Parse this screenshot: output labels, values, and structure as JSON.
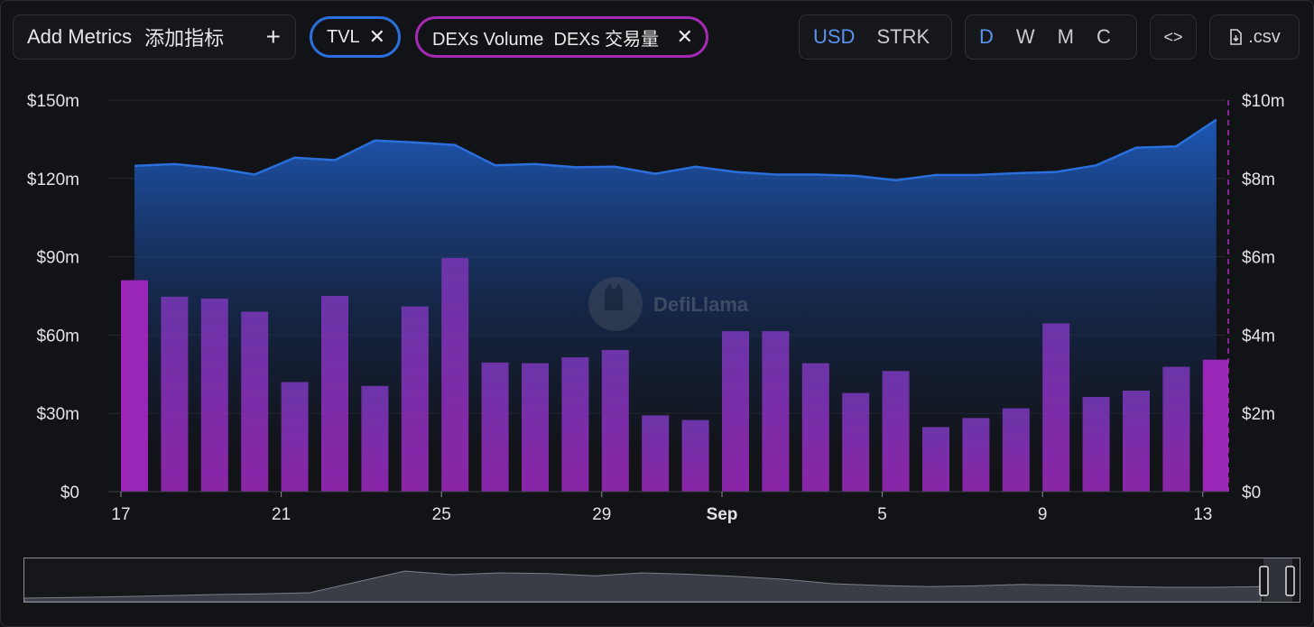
{
  "toolbar": {
    "add_metrics_label": "Add Metrics",
    "add_metrics_cn": "添加指标",
    "add_icon": "plus-icon",
    "active_metrics": [
      {
        "label": "TVL",
        "color": "#2a6fdb"
      },
      {
        "label": "DEXs Volume  DEXs 交易量",
        "color": "#a42ab4"
      }
    ],
    "remove_icon": "close-icon",
    "currency_options": [
      "USD",
      "STRK"
    ],
    "currency_selected": "USD",
    "granularity_options": [
      "D",
      "W",
      "M",
      "C"
    ],
    "granularity_selected": "D",
    "embed_label": "<>",
    "csv_label": ".csv",
    "csv_icon": "download-file-icon"
  },
  "watermark": "DefiLlama",
  "chart_data": {
    "type": "bar",
    "x_tick_labels": [
      "17",
      "21",
      "25",
      "29",
      "Sep",
      "5",
      "9",
      "13"
    ],
    "x_tick_positions_day_index": [
      0,
      4,
      8,
      12,
      15,
      19,
      23,
      27
    ],
    "left_axis": {
      "ticks": [
        "$0",
        "$30m",
        "$60m",
        "$90m",
        "$120m",
        "$150m"
      ],
      "ylim": [
        0,
        150
      ]
    },
    "right_axis": {
      "ticks": [
        "$0",
        "$2m",
        "$4m",
        "$6m",
        "$8m",
        "$10m"
      ],
      "ylim": [
        0,
        10
      ]
    },
    "series": [
      {
        "name": "TVL",
        "kind": "area",
        "axis": "left",
        "unit": "$m",
        "color": "#2a6fdb",
        "values": [
          124.8,
          125.5,
          124.0,
          121.5,
          128.0,
          127.0,
          134.5,
          133.8,
          132.8,
          125.0,
          125.5,
          124.3,
          124.5,
          121.8,
          124.5,
          122.5,
          121.5,
          121.5,
          121.0,
          119.3,
          121.3,
          121.3,
          122.0,
          122.5,
          125.0,
          131.8,
          132.3,
          142.5
        ]
      },
      {
        "name": "DEXs Volume",
        "kind": "bar",
        "axis": "right",
        "unit": "$m",
        "color": "#8e2bb0",
        "values": [
          5.4,
          4.98,
          4.93,
          4.6,
          2.8,
          5.0,
          2.7,
          4.73,
          5.97,
          3.3,
          3.28,
          3.43,
          3.62,
          1.95,
          1.83,
          4.1,
          4.1,
          3.28,
          2.52,
          3.08,
          1.65,
          1.88,
          2.13,
          4.3,
          2.42,
          2.58,
          3.19,
          3.37
        ]
      }
    ],
    "overview": {
      "values": [
        0.1,
        0.12,
        0.14,
        0.17,
        0.2,
        0.22,
        0.25,
        0.55,
        0.85,
        0.75,
        0.8,
        0.78,
        0.72,
        0.8,
        0.76,
        0.7,
        0.62,
        0.5,
        0.45,
        0.42,
        0.44,
        0.48,
        0.46,
        0.42,
        0.4,
        0.4,
        0.42
      ]
    }
  }
}
